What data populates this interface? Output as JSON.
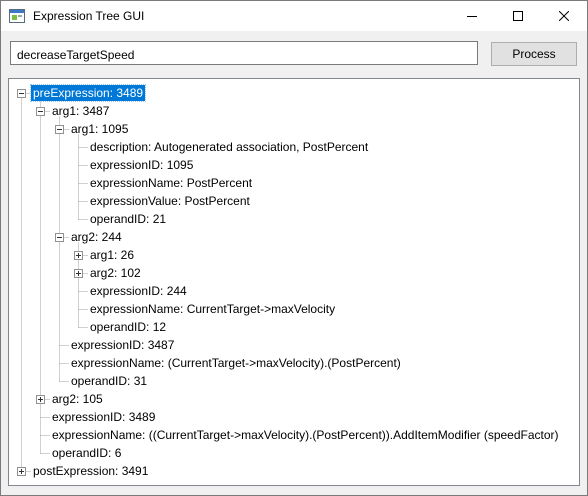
{
  "window": {
    "title": "Expression Tree GUI"
  },
  "input": {
    "value": "decreaseTargetSpeed"
  },
  "process_button": {
    "label": "Process"
  },
  "tree": {
    "selected_index": 0,
    "nodes": [
      {
        "label": "preExpression: 3489",
        "depth": 0,
        "expander": "expanded"
      },
      {
        "label": "arg1: 3487",
        "depth": 1,
        "expander": "expanded"
      },
      {
        "label": "arg1: 1095",
        "depth": 2,
        "expander": "expanded"
      },
      {
        "label": "description: Autogenerated association, PostPercent",
        "depth": 3,
        "expander": "none"
      },
      {
        "label": "expressionID: 1095",
        "depth": 3,
        "expander": "none"
      },
      {
        "label": "expressionName: PostPercent",
        "depth": 3,
        "expander": "none"
      },
      {
        "label": "expressionValue: PostPercent",
        "depth": 3,
        "expander": "none"
      },
      {
        "label": "operandID: 21",
        "depth": 3,
        "expander": "none"
      },
      {
        "label": "arg2: 244",
        "depth": 2,
        "expander": "expanded"
      },
      {
        "label": "arg1: 26",
        "depth": 3,
        "expander": "collapsed"
      },
      {
        "label": "arg2: 102",
        "depth": 3,
        "expander": "collapsed"
      },
      {
        "label": "expressionID: 244",
        "depth": 3,
        "expander": "none"
      },
      {
        "label": "expressionName: CurrentTarget->maxVelocity",
        "depth": 3,
        "expander": "none"
      },
      {
        "label": "operandID: 12",
        "depth": 3,
        "expander": "none"
      },
      {
        "label": "expressionID: 3487",
        "depth": 2,
        "expander": "none"
      },
      {
        "label": "expressionName: (CurrentTarget->maxVelocity).(PostPercent)",
        "depth": 2,
        "expander": "none"
      },
      {
        "label": "operandID: 31",
        "depth": 2,
        "expander": "none"
      },
      {
        "label": "arg2: 105",
        "depth": 1,
        "expander": "collapsed"
      },
      {
        "label": "expressionID: 3489",
        "depth": 1,
        "expander": "none"
      },
      {
        "label": "expressionName: ((CurrentTarget->maxVelocity).(PostPercent)).AddItemModifier (speedFactor)",
        "depth": 1,
        "expander": "none"
      },
      {
        "label": "operandID: 6",
        "depth": 1,
        "expander": "none"
      },
      {
        "label": "postExpression: 3491",
        "depth": 0,
        "expander": "collapsed"
      }
    ]
  },
  "colors": {
    "selection": "#0078d7",
    "lines": "#a0a0a0"
  },
  "icons": {
    "app": "window-app-icon",
    "minimize": "minimize-icon",
    "maximize": "maximize-icon",
    "close": "close-icon"
  }
}
